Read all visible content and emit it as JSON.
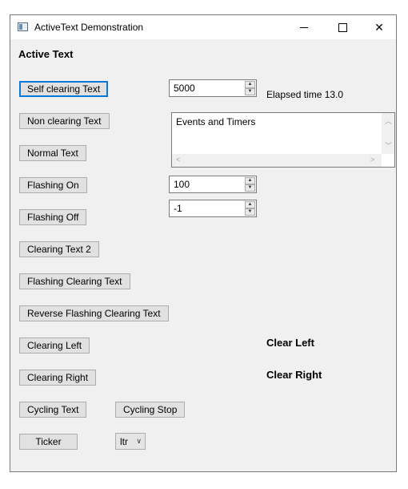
{
  "window": {
    "title": "ActiveText Demonstration"
  },
  "heading": "Active Text",
  "buttons": {
    "self_clearing": "Self clearing Text",
    "non_clearing": "Non clearing Text",
    "normal": "Normal Text",
    "flashing_on": "Flashing On",
    "flashing_off": "Flashing Off",
    "clearing_text_2": "Clearing Text 2",
    "flashing_clearing": "Flashing Clearing Text",
    "reverse_flashing_clearing": "Reverse Flashing Clearing Text",
    "clearing_left": "Clearing Left",
    "clearing_right": "Clearing Right",
    "cycling_text": "Cycling Text",
    "cycling_stop": "Cycling Stop",
    "ticker": "Ticker"
  },
  "spinners": {
    "timeout": "5000",
    "flash_rate": "100",
    "third": "-1"
  },
  "elapsed": "Elapsed time 13.0",
  "events_text": "Events and Timers",
  "labels": {
    "clear_left": "Clear Left",
    "clear_right": "Clear Right"
  },
  "direction_select": {
    "value": "ltr"
  },
  "icons": {
    "spin_up": "▲",
    "spin_down": "▼",
    "scroll_up": "︿",
    "scroll_down": "﹀",
    "scroll_left": "<",
    "scroll_right": ">",
    "select_chevron": "∨",
    "close": "✕"
  }
}
